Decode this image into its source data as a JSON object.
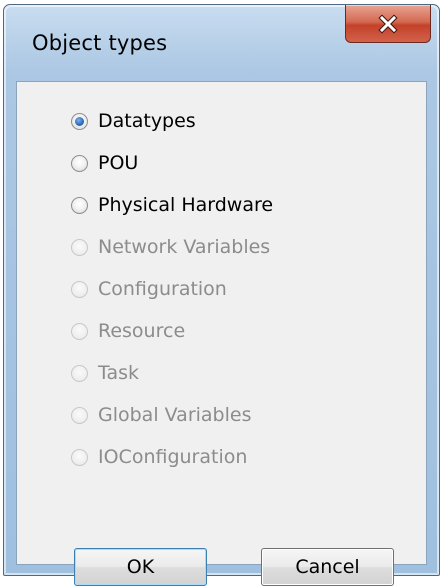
{
  "window": {
    "title": "Object types",
    "close_label": "x"
  },
  "options": [
    {
      "label": "Datatypes",
      "checked": true,
      "enabled": true
    },
    {
      "label": "POU",
      "checked": false,
      "enabled": true
    },
    {
      "label": "Physical Hardware",
      "checked": false,
      "enabled": true
    },
    {
      "label": "Network Variables",
      "checked": false,
      "enabled": false
    },
    {
      "label": "Configuration",
      "checked": false,
      "enabled": false
    },
    {
      "label": "Resource",
      "checked": false,
      "enabled": false
    },
    {
      "label": "Task",
      "checked": false,
      "enabled": false
    },
    {
      "label": "Global Variables",
      "checked": false,
      "enabled": false
    },
    {
      "label": "IOConfiguration",
      "checked": false,
      "enabled": false
    }
  ],
  "buttons": {
    "ok_label": "OK",
    "cancel_label": "Cancel"
  },
  "colors": {
    "frame": "#abc7e3",
    "client_background": "#f0f0f0",
    "close_button": "#c4412a",
    "disabled_text": "#8c8c8c",
    "default_button_border": "#3c7fb1"
  }
}
